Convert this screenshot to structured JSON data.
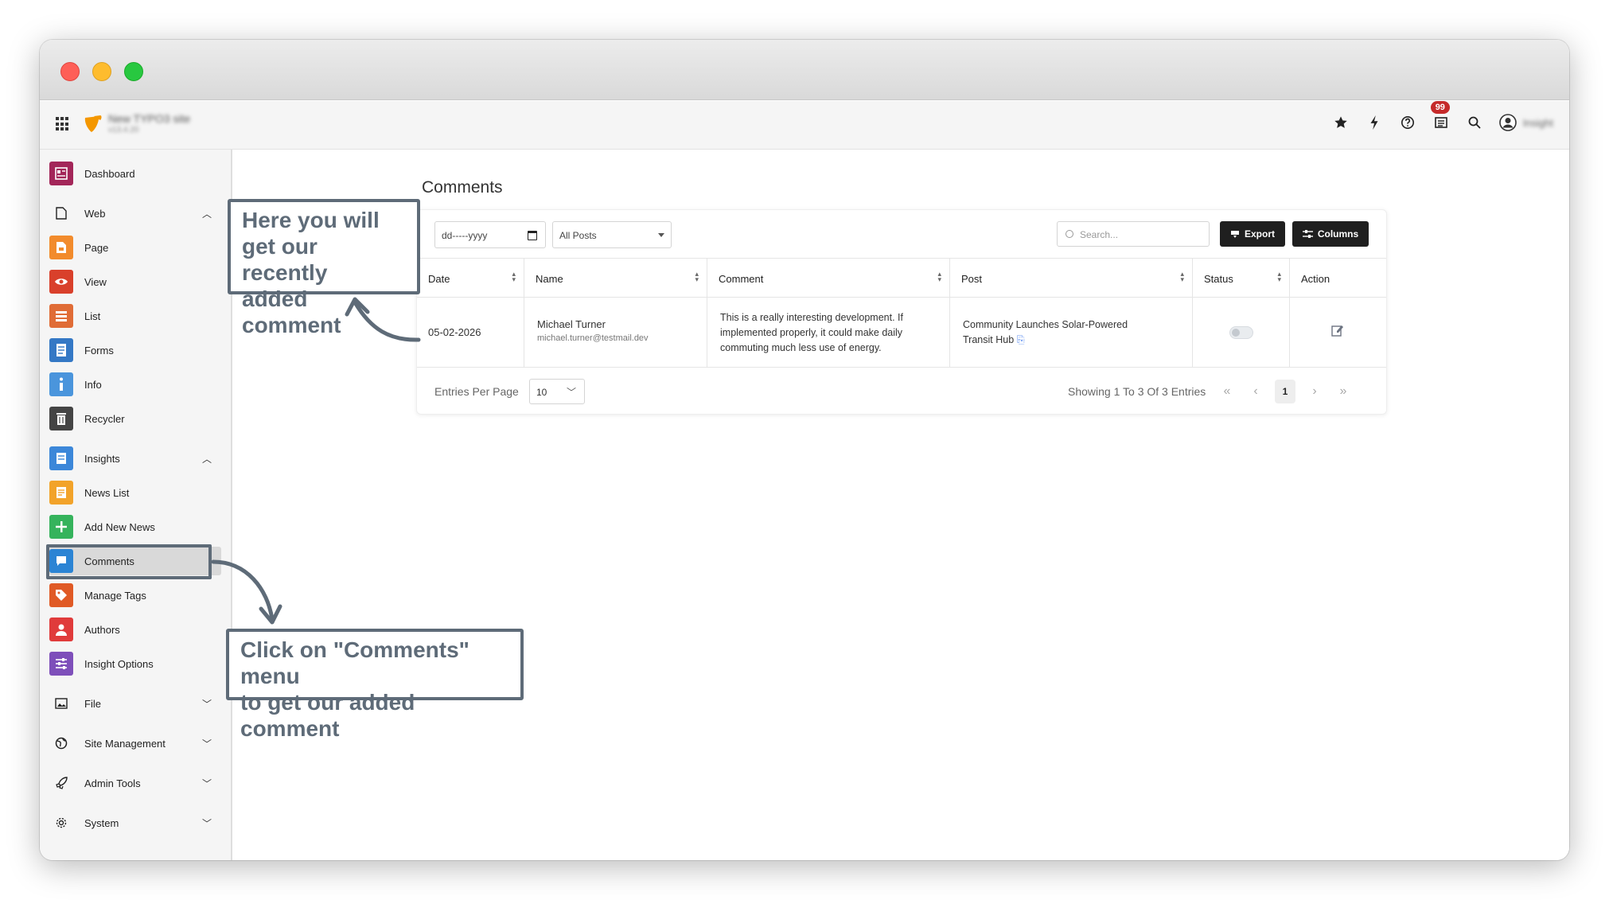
{
  "topbar": {
    "site_name": "New TYPO3 site",
    "site_version": "v13.4.20",
    "notification_count": "99",
    "user_name": "Insight"
  },
  "sidebar": {
    "items": [
      {
        "label": "Dashboard",
        "icon": "dashboard-icon",
        "color": "#a32659"
      },
      {
        "label": "Web",
        "icon": "page-outline-icon",
        "group": true
      },
      {
        "label": "Page",
        "icon": "page-icon",
        "color": "#f28b2c"
      },
      {
        "label": "View",
        "icon": "eye-icon",
        "color": "#d9402b"
      },
      {
        "label": "List",
        "icon": "list-icon",
        "color": "#e06c36"
      },
      {
        "label": "Forms",
        "icon": "forms-icon",
        "color": "#3478c5"
      },
      {
        "label": "Info",
        "icon": "info-icon",
        "color": "#4a95dc"
      },
      {
        "label": "Recycler",
        "icon": "trash-icon",
        "color": "#444444"
      },
      {
        "label": "Insights",
        "icon": "insights-icon",
        "color": "#3c87d9",
        "group": true
      },
      {
        "label": "News List",
        "icon": "news-list-icon",
        "color": "#f2a32a"
      },
      {
        "label": "Add New News",
        "icon": "plus-icon",
        "color": "#35b35c"
      },
      {
        "label": "Comments",
        "icon": "comment-icon",
        "color": "#2b84d4"
      },
      {
        "label": "Manage Tags",
        "icon": "tag-icon",
        "color": "#e05a25"
      },
      {
        "label": "Authors",
        "icon": "person-icon",
        "color": "#e03b3b"
      },
      {
        "label": "Insight Options",
        "icon": "sliders-icon",
        "color": "#7e4fba"
      },
      {
        "label": "File",
        "icon": "image-icon",
        "group": true
      },
      {
        "label": "Site Management",
        "icon": "globe-icon",
        "group": true
      },
      {
        "label": "Admin Tools",
        "icon": "rocket-icon",
        "group": true
      },
      {
        "label": "System",
        "icon": "gear-icon",
        "group": true
      }
    ]
  },
  "main": {
    "title": "Comments",
    "filters": {
      "date_placeholder": "dd-----yyyy",
      "post_filter": "All Posts",
      "search_placeholder": "Search..."
    },
    "buttons": {
      "export": "Export",
      "columns": "Columns"
    },
    "table": {
      "columns": [
        "Date",
        "Name",
        "Comment",
        "Post",
        "Status",
        "Action"
      ],
      "rows": [
        {
          "date": "05-02-2026",
          "name": "Michael Turner",
          "email": "michael.turner@testmail.dev",
          "comment_lines": [
            "This is a really interesting development. If",
            "implemented properly, it could make daily",
            "commuting much less use of energy."
          ],
          "post_lines": [
            "Community Launches Solar-Powered",
            "Transit Hub"
          ],
          "status_enabled": false
        }
      ]
    },
    "pagination": {
      "entries_per_page_label": "Entries Per Page",
      "entries_per_page_value": "10",
      "showing_text": "Showing 1 To 3 Of 3 Entries",
      "first": "«",
      "prev": "‹",
      "current_page": "1",
      "next": "›",
      "last": "»"
    }
  },
  "annotations": {
    "top_callout": [
      "Here you will",
      "get our recently",
      "added comment"
    ],
    "bottom_callout": [
      "Click on \"Comments\" menu",
      "to get our added comment"
    ],
    "arrow_color": "#5e6b78"
  }
}
